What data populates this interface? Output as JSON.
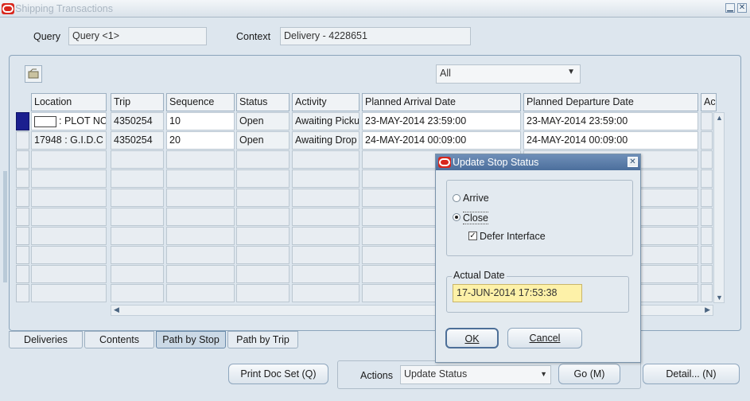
{
  "window": {
    "title": "Shipping Transactions",
    "minimize_icon": "minimize-icon",
    "close_icon": "close-icon"
  },
  "header": {
    "query_label": "Query",
    "query_value": "Query <1>",
    "context_label": "Context",
    "context_value": "Delivery - 4228651"
  },
  "filter": {
    "selected": "All"
  },
  "grid": {
    "columns": [
      "Location",
      "Trip",
      "Sequence",
      "Status",
      "Activity",
      "Planned Arrival Date",
      "Planned Departure Date",
      "Ac"
    ],
    "rows": [
      {
        "location": ": PLOT NC",
        "trip": "4350254",
        "sequence": "10",
        "status": "Open",
        "activity": "Awaiting Picku",
        "arrival": "23-MAY-2014 23:59:00",
        "departure": "23-MAY-2014 23:59:00"
      },
      {
        "location": "17948 : G.I.D.C",
        "trip": "4350254",
        "sequence": "20",
        "status": "Open",
        "activity": "Awaiting Drop",
        "arrival": "24-MAY-2014 00:09:00",
        "departure": "24-MAY-2014 00:09:00"
      }
    ]
  },
  "tabs": [
    "Deliveries",
    "Contents",
    "Path by Stop",
    "Path by Trip"
  ],
  "active_tab": "Path by Stop",
  "footer": {
    "print_doc_set": "Print Doc Set (Q)",
    "actions_label": "Actions",
    "actions_value": "Update Status",
    "go": "Go (M)",
    "detail": "Detail... (N)"
  },
  "dialog": {
    "title": "Update Stop Status",
    "arrive_label": "Arrive",
    "close_label": "Close",
    "selected_option": "Close",
    "defer_label": "Defer Interface",
    "defer_checked": true,
    "actual_date_label": "Actual Date",
    "actual_date_value": "17-JUN-2014 17:53:38",
    "ok": "OK",
    "cancel": "Cancel"
  },
  "colors": {
    "accent": "#1b1f8f",
    "title_bar_dialog": "#4c6f9c",
    "date_field": "#fdf1a8",
    "oracle_red": "#d8261c"
  }
}
